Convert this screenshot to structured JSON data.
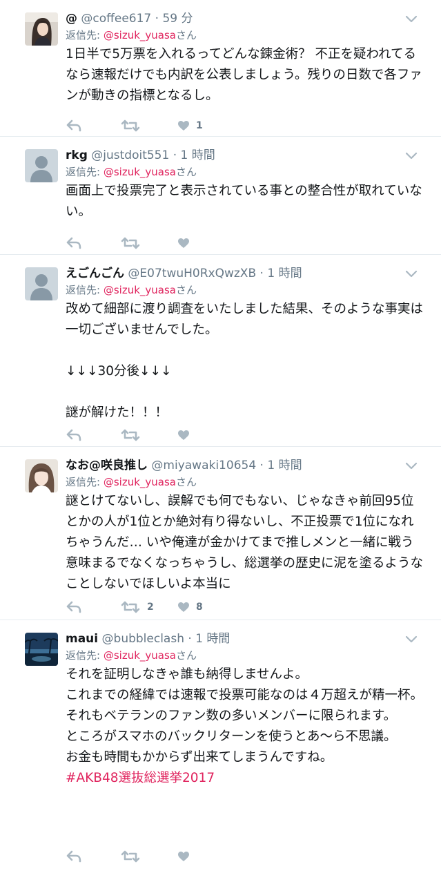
{
  "reply_prefix": "返信先:",
  "reply_suffix": "さん",
  "tweets": [
    {
      "name": "@",
      "handle": "@coffee617",
      "dot": "·",
      "time": "59 分",
      "reply_to": "@sizuk_yuasa",
      "text": "1日半で5万票を入れるってどんな錬金術？ 不正を疑われてるなら速報だけでも内訳を公表しましょう。残りの日数で各ファンが動きの指標となるし。",
      "retweets": "",
      "likes": "1"
    },
    {
      "name": "rkg",
      "handle": "@justdoit551",
      "dot": "·",
      "time": "1 時間",
      "reply_to": "@sizuk_yuasa",
      "text": "画面上で投票完了と表示されている事との整合性が取れていない。",
      "retweets": "",
      "likes": ""
    },
    {
      "name": "えごんごん",
      "handle": "@E07twuH0RxQwzXB",
      "dot": "·",
      "time": "1 時間",
      "reply_to": "@sizuk_yuasa",
      "text": "改めて細部に渡り調査をいたしました結果、そのような事実は一切ございませんでした。\n\n↓↓↓30分後↓↓↓\n\n謎が解けた！！！",
      "retweets": "",
      "likes": ""
    },
    {
      "name": "なお@咲良推し",
      "handle": "@miyawaki10654",
      "dot": "·",
      "time": "1 時間",
      "reply_to": "@sizuk_yuasa",
      "text": "謎とけてないし、誤解でも何でもない、じゃなきゃ前回95位とかの人が1位とか絶対有り得ないし、不正投票で1位になれちゃうんだ… いや俺達が金かけてまで推しメンと一緒に戦う意味まるでなくなっちゃうし、総選挙の歴史に泥を塗るようなことしないでほしいよ本当に",
      "retweets": "2",
      "likes": "8"
    },
    {
      "name": "maui",
      "handle": "@bubbleclash",
      "dot": "·",
      "time": "1 時間",
      "reply_to": "@sizuk_yuasa",
      "text": "それを証明しなきゃ誰も納得しませんよ。\nこれまでの経緯では速報で投票可能なのは４万超えが精一杯。\nそれもベテランのファン数の多いメンバーに限られます。\nところがスマホのバックリターンを使うとあ～ら不思議。\nお金も時間もかからず出来てしまうんですね。",
      "hashtag": "#AKB48選抜総選挙2017",
      "retweets": "",
      "likes": ""
    }
  ],
  "colors": {
    "text": "#14171a",
    "muted": "#657786",
    "mention": "#e0245e",
    "icon": "#aab8c2",
    "divider": "#e6ecf0"
  },
  "icons": [
    "chevron-down-icon",
    "reply-icon",
    "retweet-icon",
    "heart-icon",
    "default-profile-icon"
  ]
}
